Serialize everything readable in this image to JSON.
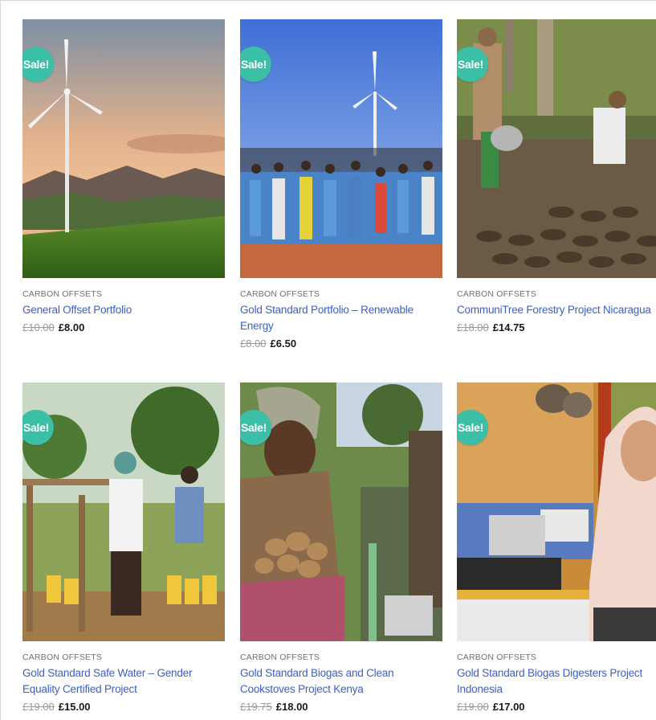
{
  "colors": {
    "sale_badge": "#3bbfa6",
    "link": "#3b5fc7",
    "category": "#6f6f6f",
    "old_price": "#9a9a9a",
    "price": "#1a1a1a"
  },
  "products": [
    {
      "badge": "Sale!",
      "category": "CARBON OFFSETS",
      "name": "General Offset Portfolio",
      "old_price": "£10.00",
      "price": "£8.00",
      "image": "wind-turbine-landscape"
    },
    {
      "badge": "Sale!",
      "category": "CARBON OFFSETS",
      "name": "Gold Standard Portfolio – Renewable Energy",
      "old_price": "£8.00",
      "price": "£6.50",
      "image": "school-children-wind-turbine"
    },
    {
      "badge": "Sale!",
      "category": "CARBON OFFSETS",
      "name": "CommuniTree Forestry Project Nicaragua",
      "old_price": "£18.00",
      "price": "£14.75",
      "image": "tree-nursery-watering"
    },
    {
      "badge": "Sale!",
      "category": "CARBON OFFSETS",
      "name": "Gold Standard Safe Water – Gender Equality Certified Project",
      "old_price": "£19.00",
      "price": "£15.00",
      "image": "water-pump-jerrycans"
    },
    {
      "badge": "Sale!",
      "category": "CARBON OFFSETS",
      "name": "Gold Standard Biogas and Clean Cookstoves Project Kenya",
      "old_price": "£19.75",
      "price": "£18.00",
      "image": "woman-holding-potatoes"
    },
    {
      "badge": "Sale!",
      "category": "CARBON OFFSETS",
      "name": "Gold Standard Biogas Digesters Project Indonesia",
      "old_price": "£19.00",
      "price": "£17.00",
      "image": "biogas-stove-kitchen"
    }
  ]
}
